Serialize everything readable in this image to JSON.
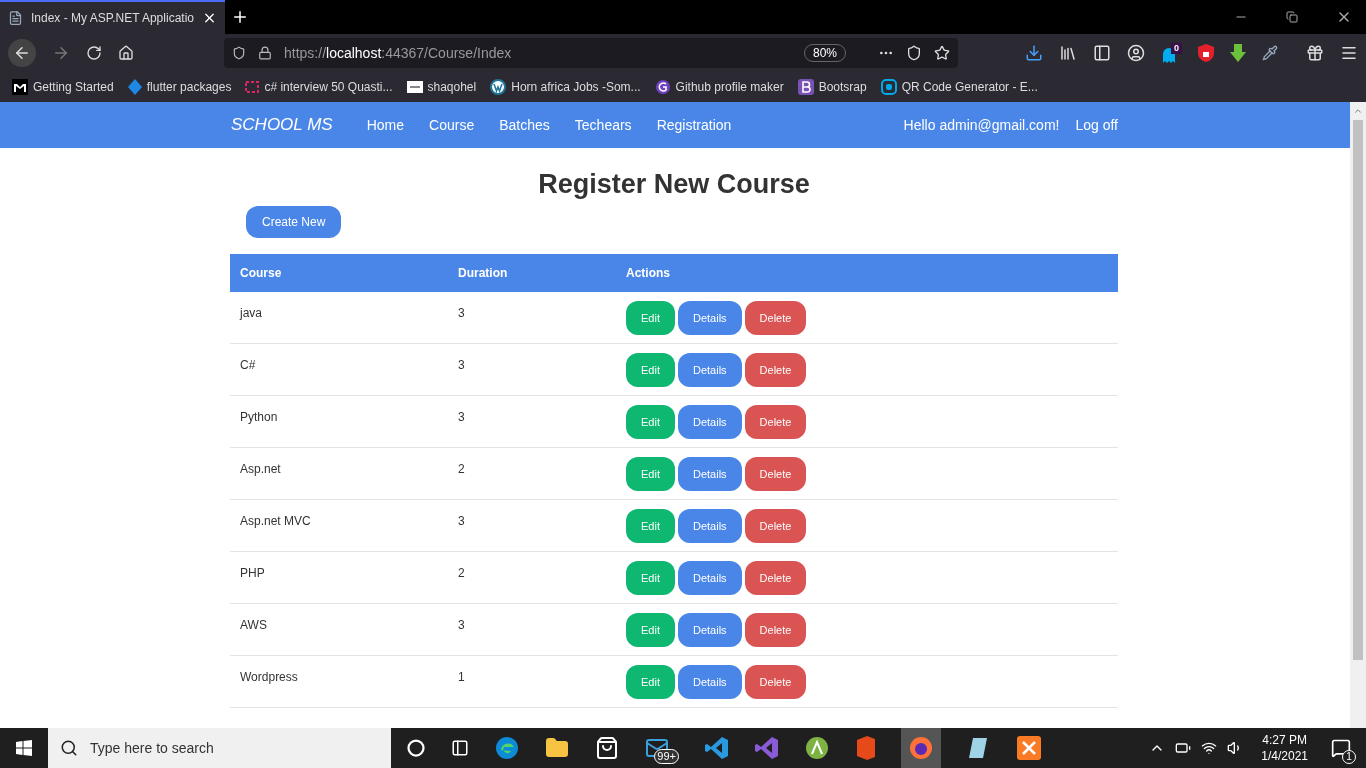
{
  "browser": {
    "tab_title": "Index - My ASP.NET Applicatio",
    "url_scheme": "https://",
    "url_host": "localhost",
    "url_rest": ":44367/Course/Index",
    "zoom": "80%",
    "extension_badge": "0",
    "bookmarks": [
      {
        "label": "Getting Started",
        "kind": "m"
      },
      {
        "label": "flutter packages",
        "kind": "flutter"
      },
      {
        "label": "c# interview 50 Quasti...",
        "kind": "code"
      },
      {
        "label": "shaqohel",
        "kind": "thumb"
      },
      {
        "label": "Horn africa Jobs -Som...",
        "kind": "wp"
      },
      {
        "label": "Github profile maker",
        "kind": "g"
      },
      {
        "label": "Bootsrap",
        "kind": "b"
      },
      {
        "label": "QR Code Generator - E...",
        "kind": "qr"
      }
    ]
  },
  "navbar": {
    "brand": "SCHOOL MS",
    "links": [
      "Home",
      "Course",
      "Batches",
      "Techears",
      "Registration"
    ],
    "greeting": "Hello admin@gmail.com!",
    "logoff": "Log off"
  },
  "heading": "Register New Course",
  "create_button": "Create New",
  "table": {
    "columns": [
      "Course",
      "Duration",
      "Actions"
    ],
    "rows": [
      {
        "course": "java",
        "duration": "3",
        "actions": [
          {
            "label": "Edit",
            "kind": "edit"
          },
          {
            "label": "Details",
            "kind": "details"
          },
          {
            "label": "Delete",
            "kind": "delete"
          }
        ]
      },
      {
        "course": "C#",
        "duration": "3",
        "actions": [
          {
            "label": "Edit",
            "kind": "edit"
          },
          {
            "label": "Details",
            "kind": "details"
          },
          {
            "label": "Delete",
            "kind": "delete"
          }
        ]
      },
      {
        "course": "Python",
        "duration": "3",
        "actions": [
          {
            "label": "Edit",
            "kind": "edit"
          },
          {
            "label": "Details",
            "kind": "details"
          },
          {
            "label": "Delete",
            "kind": "delete"
          }
        ]
      },
      {
        "course": "Asp.net",
        "duration": "2",
        "actions": [
          {
            "label": "Edit",
            "kind": "edit"
          },
          {
            "label": "Details",
            "kind": "details"
          },
          {
            "label": "Delete",
            "kind": "delete"
          }
        ]
      },
      {
        "course": "Asp.net MVC",
        "duration": "3",
        "actions": [
          {
            "label": "Edit",
            "kind": "edit"
          },
          {
            "label": "Details",
            "kind": "details"
          },
          {
            "label": "Delete",
            "kind": "delete"
          }
        ]
      },
      {
        "course": "PHP",
        "duration": "2",
        "actions": [
          {
            "label": "Edit",
            "kind": "edit"
          },
          {
            "label": "Details",
            "kind": "details"
          },
          {
            "label": "Delete",
            "kind": "delete"
          }
        ]
      },
      {
        "course": "AWS",
        "duration": "3",
        "actions": [
          {
            "label": "Edit",
            "kind": "edit"
          },
          {
            "label": "Details",
            "kind": "details"
          },
          {
            "label": "Delete",
            "kind": "delete"
          }
        ]
      },
      {
        "course": "Wordpress",
        "duration": "1",
        "actions": [
          {
            "label": "Edit",
            "kind": "edit"
          },
          {
            "label": "Details",
            "kind": "details"
          },
          {
            "label": "Delete",
            "kind": "delete"
          }
        ]
      }
    ]
  },
  "taskbar": {
    "search_placeholder": "Type here to search",
    "mail_badge": "99+",
    "time": "4:27 PM",
    "date": "1/4/2021",
    "notification_count": "1"
  }
}
